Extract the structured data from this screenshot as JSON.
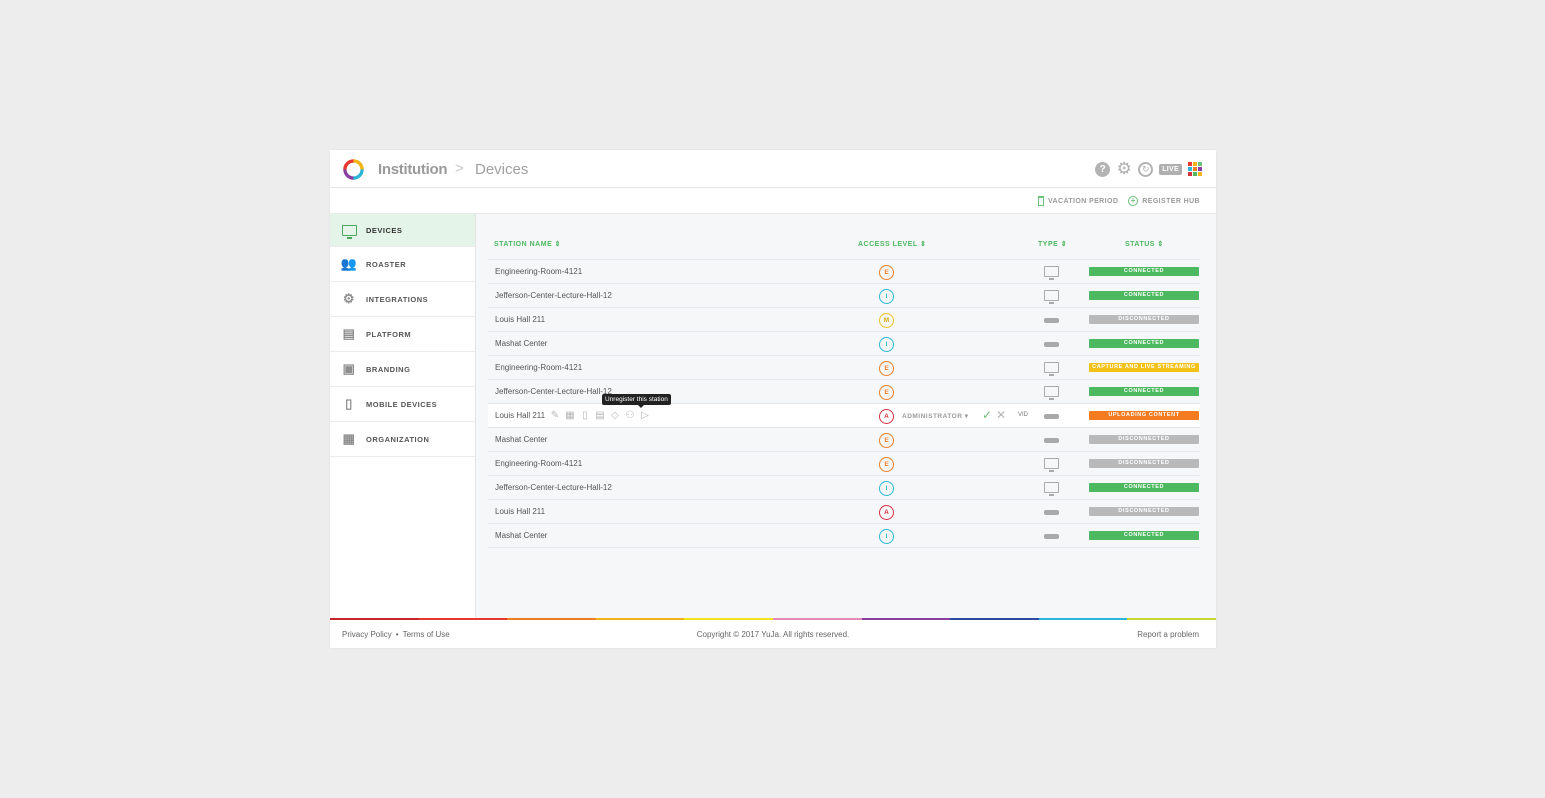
{
  "header": {
    "breadcrumb_root": "Institution",
    "breadcrumb_sep": ">",
    "breadcrumb_current": "Devices",
    "help_glyph": "?",
    "live_label": "LIVE",
    "grid_colors": [
      "#e8372d",
      "#f3b317",
      "#6cc07a",
      "#2bb6d8",
      "#ef7d22",
      "#8a3fa0",
      "#d63040",
      "#4cb860",
      "#f3b317"
    ]
  },
  "subbar": {
    "vacation_label": "VACATION PERIOD",
    "register_label": "REGISTER HUB",
    "plus_glyph": "+"
  },
  "sidebar": {
    "items": [
      {
        "label": "DEVICES",
        "icon": "monitor-icon",
        "glyph": ""
      },
      {
        "label": "ROASTER",
        "icon": "people-icon",
        "glyph": "👥"
      },
      {
        "label": "INTEGRATIONS",
        "icon": "gears-icon",
        "glyph": "⚙"
      },
      {
        "label": "PLATFORM",
        "icon": "server-icon",
        "glyph": "▤"
      },
      {
        "label": "BRANDING",
        "icon": "branding-icon",
        "glyph": "▣"
      },
      {
        "label": "MOBILE DEVICES",
        "icon": "mobile-icon",
        "glyph": "▯"
      },
      {
        "label": "ORGANIZATION",
        "icon": "building-icon",
        "glyph": "▦"
      }
    ]
  },
  "table": {
    "headers": {
      "station": "STATION NAME ⇕",
      "access": "ACCESS LEVEL ⇕",
      "type": "TYPE ⇕",
      "status": "STATUS ⇕"
    },
    "rows": [
      {
        "name": "Engineering-Room-4121",
        "access": "E",
        "type": "monitor",
        "status": "CONNECTED",
        "status_color": "#4cb860"
      },
      {
        "name": "Jefferson-Center-Lecture-Hall-12",
        "access": "I",
        "type": "monitor",
        "status": "CONNECTED",
        "status_color": "#4cb860"
      },
      {
        "name": "Louis Hall 211",
        "access": "M",
        "type": "hub",
        "status": "DISCONNECTED",
        "status_color": "#b9b9b9"
      },
      {
        "name": "Mashat Center",
        "access": "I",
        "type": "hub",
        "status": "CONNECTED",
        "status_color": "#4cb860"
      },
      {
        "name": "Engineering-Room-4121",
        "access": "E",
        "type": "monitor",
        "status": "CAPTURE AND LIVE STREAMING",
        "status_color": "#f4c117"
      },
      {
        "name": "Jefferson-Center-Lecture-Hall-12",
        "access": "E",
        "type": "monitor",
        "status": "CONNECTED",
        "status_color": "#4cb860"
      },
      {
        "name": "Louis Hall 211",
        "access": "A",
        "type": "hub",
        "status": "UPLOADING CONTENT",
        "status_color": "#f47b20"
      },
      {
        "name": "Mashat Center",
        "access": "E",
        "type": "hub",
        "status": "DISCONNECTED",
        "status_color": "#b9b9b9"
      },
      {
        "name": "Engineering-Room-4121",
        "access": "E",
        "type": "monitor",
        "status": "DISCONNECTED",
        "status_color": "#b9b9b9"
      },
      {
        "name": "Jefferson-Center-Lecture-Hall-12",
        "access": "I",
        "type": "monitor",
        "status": "CONNECTED",
        "status_color": "#4cb860"
      },
      {
        "name": "Louis Hall 211",
        "access": "A",
        "type": "hub",
        "status": "DISCONNECTED",
        "status_color": "#b9b9b9"
      },
      {
        "name": "Mashat Center",
        "access": "I",
        "type": "hub",
        "status": "CONNECTED",
        "status_color": "#4cb860"
      }
    ],
    "hover_row": {
      "index": 6,
      "tooltip": "Unregister this station",
      "role_label": "ADMINISTRATOR ▾",
      "check_glyph": "✓",
      "cancel_glyph": "✕",
      "vid_label": "VID",
      "action_icons": [
        {
          "name": "edit-icon",
          "glyph": "✎"
        },
        {
          "name": "calendar-icon",
          "glyph": "▦"
        },
        {
          "name": "bookmark-icon",
          "glyph": "▯"
        },
        {
          "name": "document-icon",
          "glyph": "▤"
        },
        {
          "name": "diamond-icon",
          "glyph": "◇"
        },
        {
          "name": "unregister-icon",
          "glyph": "⚇"
        },
        {
          "name": "play-icon",
          "glyph": "▷"
        }
      ]
    }
  },
  "footer": {
    "privacy": "Privacy Policy",
    "dot": "•",
    "terms": "Terms of Use",
    "copyright": "Copyright © 2017 YuJa. All rights reserved.",
    "report": "Report a problem",
    "rainbow": [
      "#c8242e",
      "#e8372d",
      "#ef7d22",
      "#f3b317",
      "#f3e31d",
      "#e48bb5",
      "#8a3fa0",
      "#2e4aa0",
      "#2bb6d8",
      "#c6d92c"
    ]
  }
}
